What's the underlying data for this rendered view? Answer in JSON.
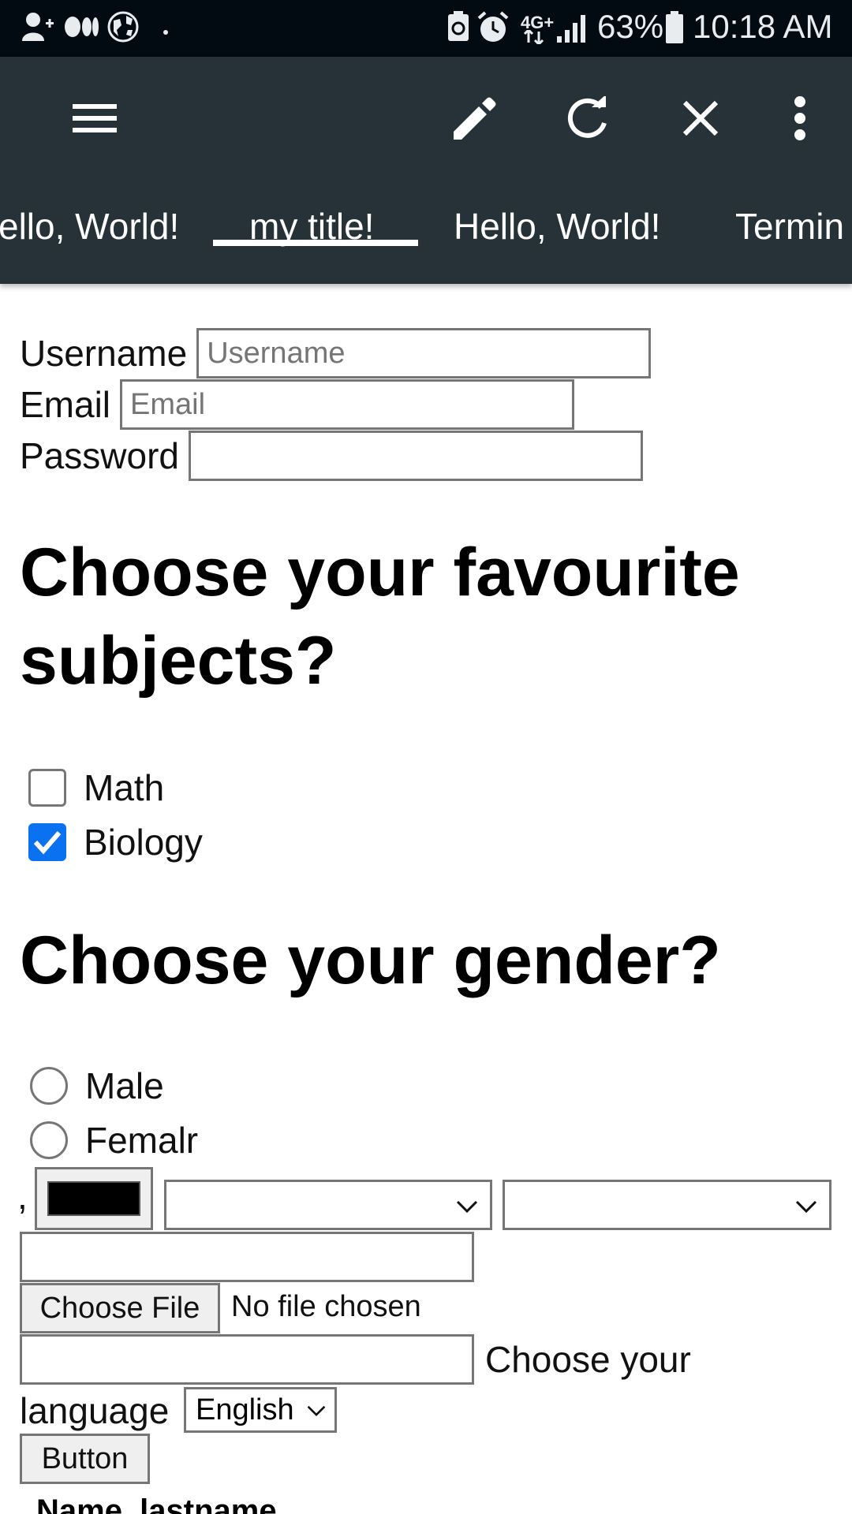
{
  "status_bar": {
    "battery": "63%",
    "time": "10:18 AM",
    "network": "4G+"
  },
  "toolbar": {
    "icons": [
      "menu-icon",
      "edit-icon",
      "refresh-icon",
      "close-icon",
      "more-vert-icon"
    ]
  },
  "tabs": [
    {
      "label": "ello, World!",
      "active": false
    },
    {
      "label": "my title!",
      "active": true
    },
    {
      "label": "Hello, World!",
      "active": false
    },
    {
      "label": "Termin",
      "active": false
    }
  ],
  "form": {
    "username_label": "Username",
    "username_placeholder": "Username",
    "email_label": "Email",
    "email_placeholder": "Email",
    "password_label": "Password"
  },
  "subjects": {
    "heading_line1": "Choose your favourite",
    "heading_line2": "subjects?",
    "options": [
      {
        "label": "Math",
        "checked": false
      },
      {
        "label": "Biology",
        "checked": true
      }
    ]
  },
  "gender": {
    "heading": "Choose your gender?",
    "options": [
      {
        "label": "Male",
        "selected": false
      },
      {
        "label": "Femalr",
        "selected": false
      }
    ]
  },
  "misc": {
    "comma": ",",
    "color_value": "#000000",
    "file_button": "Choose File",
    "file_status": "No file chosen",
    "language_prefix": "Choose your",
    "language_suffix": "language",
    "language_selected": "English",
    "button_label": "Button",
    "table_header": "Name, lastname"
  },
  "colors": {
    "status_bar_bg": "#030b12",
    "app_bar_bg": "#263238",
    "checkbox_checked": "#0a72f0"
  }
}
